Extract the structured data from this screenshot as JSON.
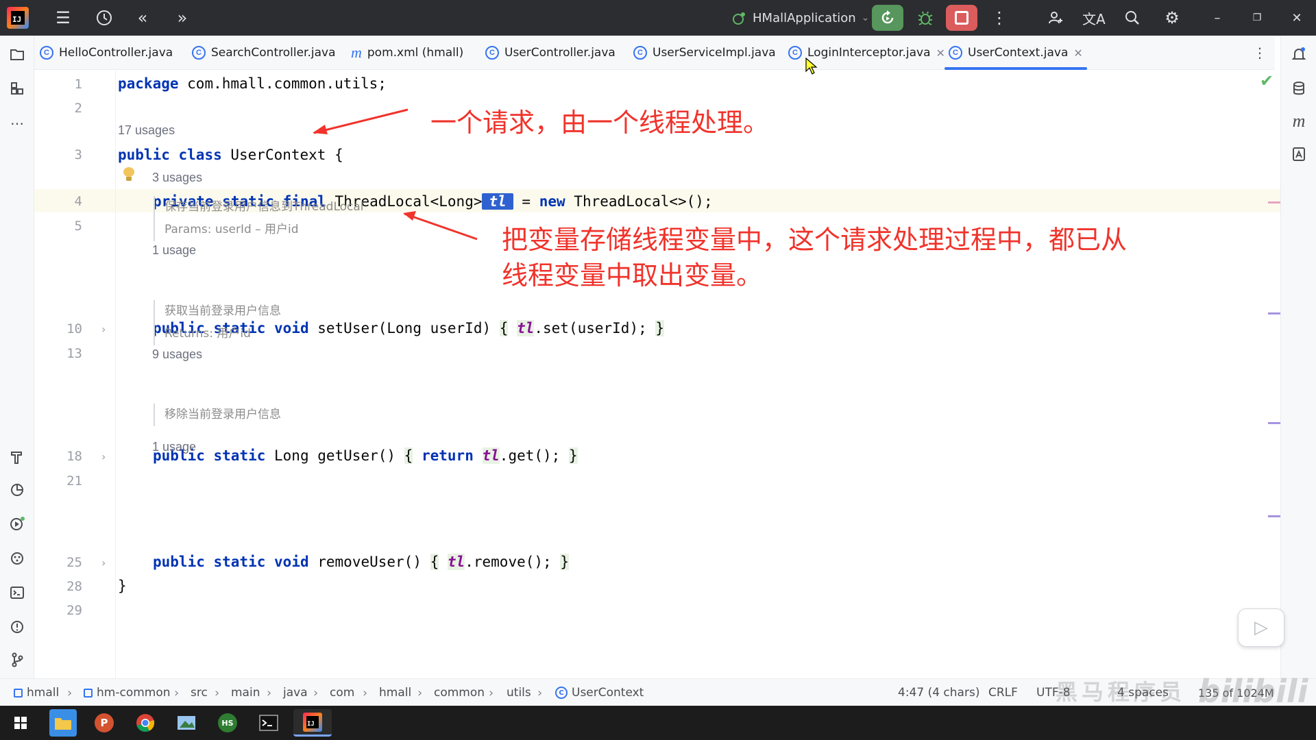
{
  "titlebar": {
    "run_config": "HMallApplication"
  },
  "tabs": [
    {
      "label": "HelloController.java",
      "icon": "class-icon"
    },
    {
      "label": "SearchController.java",
      "icon": "class-icon"
    },
    {
      "label": "pom.xml (hmall)",
      "icon": "maven-icon"
    },
    {
      "label": "UserController.java",
      "icon": "class-icon"
    },
    {
      "label": "UserServiceImpl.java",
      "icon": "class-icon"
    },
    {
      "label": "LoginInterceptor.java",
      "icon": "class-icon",
      "closable": true
    },
    {
      "label": "UserContext.java",
      "icon": "class-icon",
      "closable": true,
      "active": true
    }
  ],
  "editor": {
    "line_numbers": [
      "1",
      "2",
      "3",
      "4",
      "5",
      "10",
      "13",
      "18",
      "21",
      "25",
      "28",
      "29"
    ],
    "code": {
      "l1_kw": "package",
      "l1_rest": " com.hmall.common.utils;",
      "usages_class": "17 usages",
      "l3_kw1": "public",
      "l3_kw2": "class",
      "l3_rest": " UserContext {",
      "usages_tl": "3 usages",
      "l4_kw1": "private",
      "l4_kw2": "static",
      "l4_kw3": "final",
      "l4_type": " ThreadLocal<Long>",
      "l4_field": "tl",
      "l4_eq": " = ",
      "l4_kw4": "new",
      "l4_rest": " ThreadLocal<>();",
      "doc1_line1": "保存当前登录用户信息到ThreadLocal",
      "doc1_line2": "Params: userId – 用户id",
      "usages_set": "1 usage",
      "l10_kw1": "public",
      "l10_kw2": "static",
      "l10_kw3": "void",
      "l10_sig": " setUser(Long userId) ",
      "l10_open": "{",
      "l10_field": "tl",
      "l10_call": ".set(userId); ",
      "l10_close": "}",
      "doc2_line1": "获取当前登录用户信息",
      "doc2_line2": "Returns: 用户id",
      "usages_get": "9 usages",
      "l18_kw1": "public",
      "l18_kw2": "static",
      "l18_sig": " Long getUser() ",
      "l18_open": "{",
      "l18_kw3": "return",
      "l18_field": "tl",
      "l18_call": ".get(); ",
      "l18_close": "}",
      "doc3_line1": "移除当前登录用户信息",
      "usages_remove": "1 usage",
      "l25_kw1": "public",
      "l25_kw2": "static",
      "l25_kw3": "void",
      "l25_sig": " removeUser() ",
      "l25_open": "{",
      "l25_field": "tl",
      "l25_call": ".remove(); ",
      "l25_close": "}",
      "l28": "}"
    }
  },
  "annotations": {
    "note1": "一个请求，由一个线程处理。",
    "note2_line1": "把变量存储线程变量中，这个请求处理过程中，都已从",
    "note2_line2": "线程变量中取出变量。",
    "color": "#f0332b"
  },
  "breadcrumb": [
    "hmall",
    "hm-common",
    "src",
    "main",
    "java",
    "com",
    "hmall",
    "common",
    "utils",
    "UserContext"
  ],
  "status": {
    "position": "4:47 (4 chars)",
    "line_sep": "CRLF",
    "encoding": "UTF-8",
    "indent": "4 spaces",
    "memory": "135 of 1024M"
  },
  "watermark": {
    "text1": "黑马程序员",
    "text2": "bilibili"
  },
  "colors": {
    "accent": "#3574f0",
    "keyword": "#0033b3",
    "field": "#871094",
    "run_green": "#57965c",
    "stop_red": "#db5c5c"
  }
}
